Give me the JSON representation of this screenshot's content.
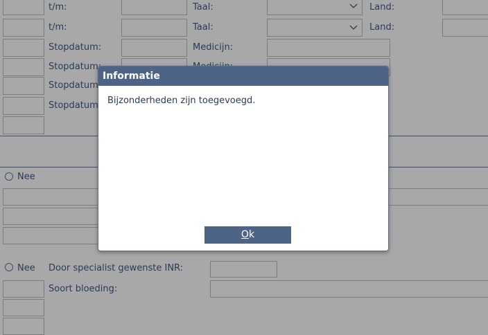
{
  "form": {
    "row1": {
      "tm_label": "t/m:",
      "taal_label": "Taal:",
      "land_label": "Land:"
    },
    "row2": {
      "tm_label": "t/m:",
      "taal_label": "Taal:",
      "land_label": "Land:"
    },
    "row3": {
      "stopdatum_label": "Stopdatum:",
      "medicijn_label": "Medicijn:"
    },
    "row4": {
      "stopdatum_label": "Stopdatum:",
      "medicijn_label": "Medicijn:"
    },
    "row5": {
      "stopdatum_label": "Stopdatum"
    },
    "row6": {
      "stopdatum_label": "Stopdatum"
    },
    "radio1": {
      "label": "Nee"
    },
    "radio2": {
      "label": "Nee"
    },
    "inr_label": "Door specialist gewenste INR:",
    "bloeding_label": "Soort bloeding:"
  },
  "dialog": {
    "title": "Informatie",
    "message": "Bijzonderheden zijn toegevoegd.",
    "ok_label": "k",
    "ok_underlined": "O"
  },
  "colors": {
    "background": "#a8a8a8",
    "header": "#4e6486",
    "text": "#2a3b57"
  }
}
